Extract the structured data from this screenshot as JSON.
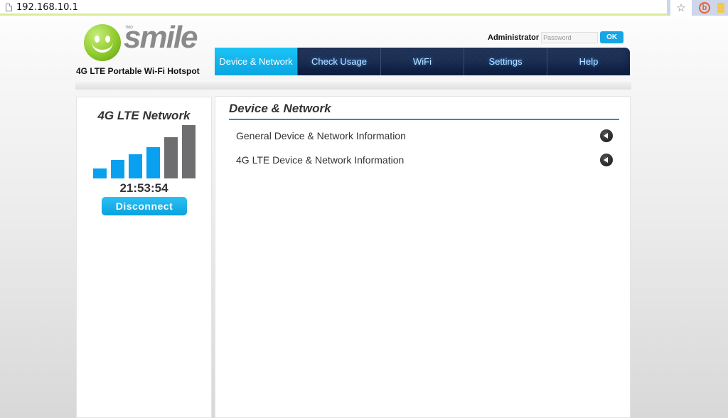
{
  "browser": {
    "url": "192.168.10.1",
    "icons": [
      "page-icon",
      "bookmark-star-icon",
      "extension-b-icon",
      "notes-extension-icon"
    ]
  },
  "header": {
    "brand": "smile",
    "trademark": "TMD",
    "tagline": "4G LTE Portable Wi-Fi Hotspot",
    "admin_label": "Administrator",
    "password_placeholder": "Password",
    "password_value": "",
    "ok_label": "OK"
  },
  "nav": {
    "active_index": 0,
    "tabs": [
      {
        "label": "Device & Network"
      },
      {
        "label": "Check Usage"
      },
      {
        "label": "WiFi"
      },
      {
        "label": "Settings"
      },
      {
        "label": "Help"
      }
    ]
  },
  "status_panel": {
    "title": "4G LTE Network",
    "signal_bars_total": 6,
    "signal_bars_active": 4,
    "active_color": "#0aa0f0",
    "inactive_color": "#6e6e70",
    "connection_time": "21:53:54",
    "disconnect_label": "Disconnect"
  },
  "main": {
    "title": "Device & Network",
    "accent_color": "#1a8fe3",
    "items": [
      {
        "label": "General Device & Network Information",
        "icon": "arrow-left-circle-icon"
      },
      {
        "label": "4G LTE Device & Network Information",
        "icon": "arrow-left-circle-icon"
      }
    ]
  }
}
